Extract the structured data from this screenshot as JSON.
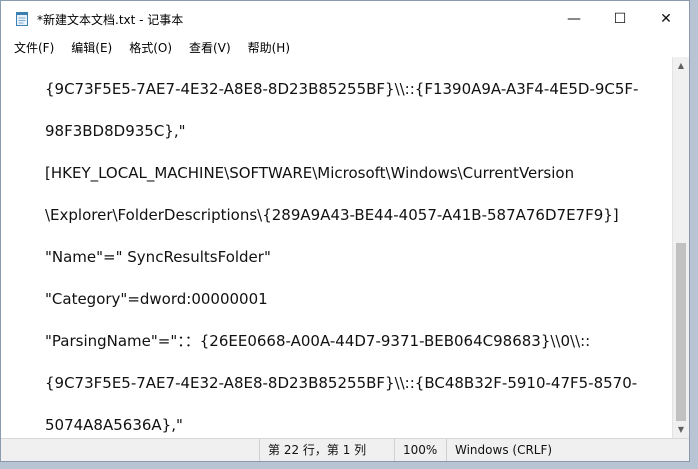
{
  "window": {
    "title": "*新建文本文档.txt - 记事本",
    "controls": {
      "minimize": "—",
      "maximize": "☐",
      "close": "✕"
    }
  },
  "menubar": {
    "items": [
      "文件(F)",
      "编辑(E)",
      "格式(O)",
      "查看(V)",
      "帮助(H)"
    ]
  },
  "editor": {
    "lines": [
      "{9C73F5E5-7AE7-4E32-A8E8-8D23B85255BF}\\\\::{F1390A9A-A3F4-4E5D-9C5F-",
      "98F3BD8D935C},\"",
      "[HKEY_LOCAL_MACHINE\\SOFTWARE\\Microsoft\\Windows\\CurrentVersion",
      "\\Explorer\\FolderDescriptions\\{289A9A43-BE44-4057-A41B-587A76D7E7F9}]",
      "\"Name\"=\"  SyncResultsFolder\"",
      "\"Category\"=dword:00000001",
      "\"ParsingName\"=\"：：{26EE0668-A00A-44D7-9371-BEB064C98683}\\\\0\\\\::",
      "{9C73F5E5-7AE7-4E32-A8E8-8D23B85255BF}\\\\::{BC48B32F-5910-47F5-8570-",
      "5074A8A5636A},\""
    ]
  },
  "statusbar": {
    "position": "第 22 行，第 1 列",
    "zoom": "100%",
    "line_ending": "Windows (CRLF)"
  }
}
